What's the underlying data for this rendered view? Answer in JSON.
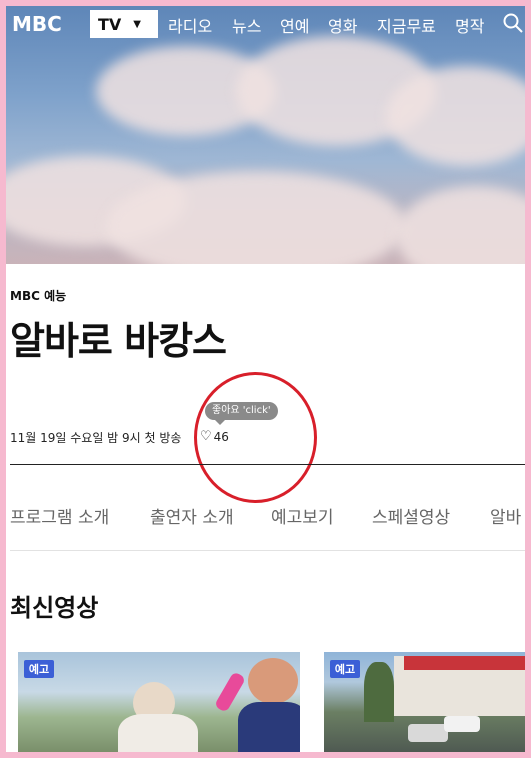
{
  "nav": {
    "logo": "MBC",
    "selected": "TV",
    "items": [
      "라디오",
      "뉴스",
      "연예",
      "영화",
      "지금무료",
      "명작"
    ]
  },
  "program": {
    "category": "MBC 예능",
    "title": "알바로 바캉스",
    "broadcast": "11월 19일 수요일 밤 9시 첫 방송",
    "like_tooltip": "좋아요 'click'",
    "like_count": "46"
  },
  "tabs": [
    "프로그램 소개",
    "출연자 소개",
    "예고보기",
    "스페셜영상",
    "알바"
  ],
  "latest": {
    "title": "최신영상",
    "thumbnails": [
      {
        "badge": "예고"
      },
      {
        "badge": "예고"
      }
    ]
  },
  "colors": {
    "page_border": "#f6b9cf",
    "annotation": "#d81f2a",
    "badge": "#3b5fd6"
  }
}
